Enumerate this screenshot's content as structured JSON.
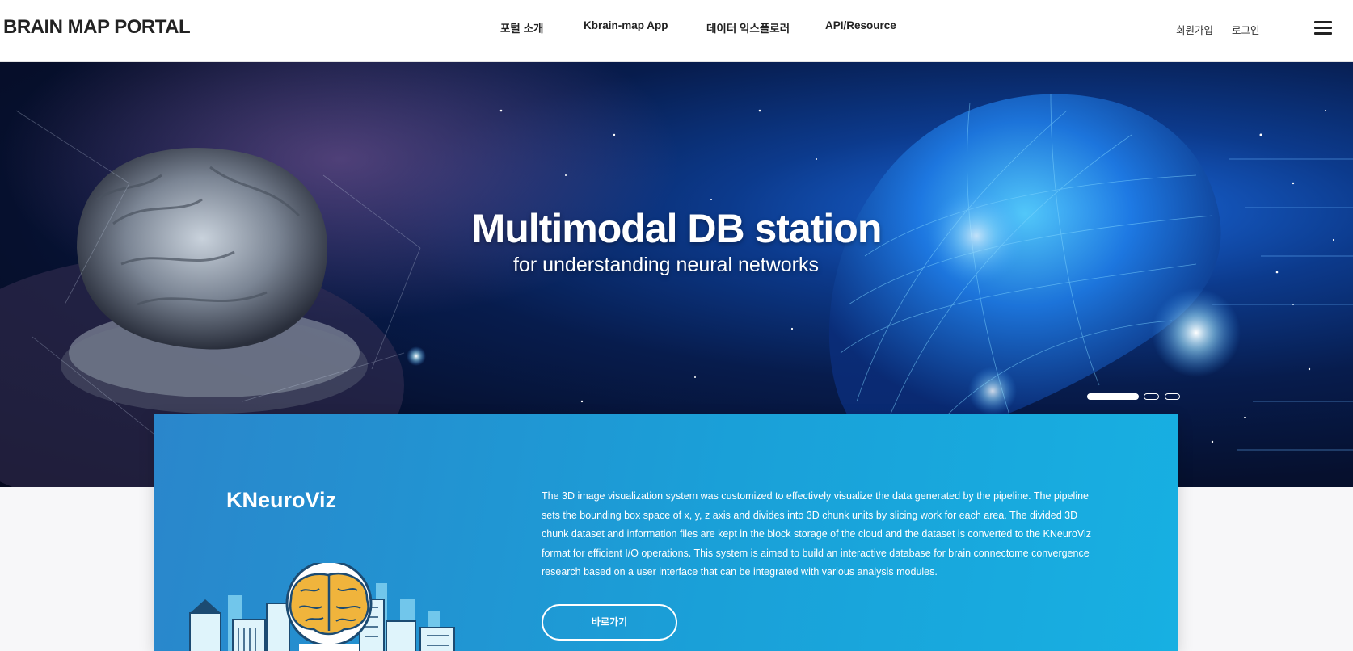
{
  "header": {
    "logo": "BRAIN MAP PORTAL",
    "nav": [
      "포털 소개",
      "Kbrain-map App",
      "데이터 익스플로러",
      "API/Resource"
    ],
    "signup": "회원가입",
    "login": "로그인",
    "menu_icon": "hamburger-menu-icon"
  },
  "hero": {
    "title": "Multimodal DB station",
    "subtitle": "for understanding neural networks",
    "slides_total": 3,
    "active_slide": 1
  },
  "card": {
    "title": "KNeuroViz",
    "description": "The 3D image visualization system was customized to effectively visualize the data generated by the pipeline. The pipeline sets the bounding box space of x, y, z axis and divides into 3D chunk units by slicing work for each area. The divided 3D chunk dataset and information files are kept in the block storage of the cloud and the dataset is converted to the KNeuroViz format for efficient I/O operations. This system is aimed to build an interactive database for brain connectome convergence research based on a user interface that can be integrated with various analysis modules.",
    "button_label": "바로가기",
    "illustration": "brain-city-icon"
  },
  "colors": {
    "card_blue": "#1aa0d8",
    "hero_blue": "#1a6be0",
    "brain_yellow": "#f0b43c"
  }
}
